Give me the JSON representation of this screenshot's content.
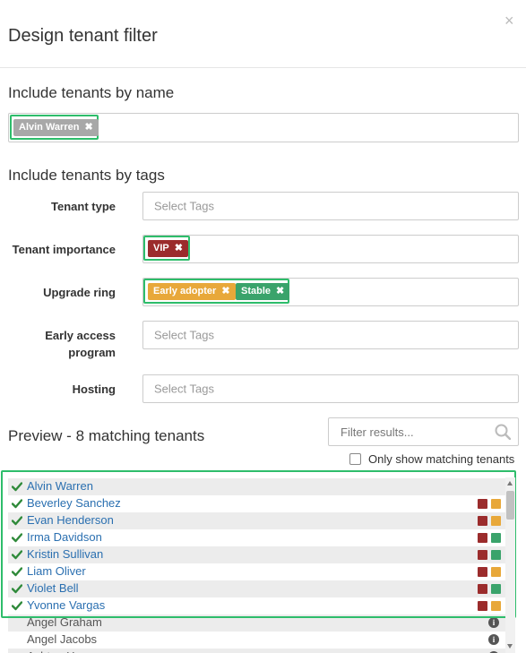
{
  "header": {
    "title": "Design tenant filter",
    "close_glyph": "×"
  },
  "by_name": {
    "title": "Include tenants by name",
    "tags": [
      {
        "label": "Alvin Warren",
        "remove": "✖"
      }
    ]
  },
  "by_tags": {
    "title": "Include tenants by tags",
    "rows": [
      {
        "label": "Tenant type",
        "placeholder": "Select Tags"
      },
      {
        "label": "Tenant importance",
        "tags": [
          {
            "label": "VIP",
            "remove": "✖"
          }
        ]
      },
      {
        "label": "Upgrade ring",
        "tags": [
          {
            "label": "Early adopter",
            "remove": "✖"
          },
          {
            "label": "Stable",
            "remove": "✖"
          }
        ]
      },
      {
        "label_line1": "Early access",
        "label_line2": "program",
        "placeholder": "Select Tags"
      },
      {
        "label": "Hosting",
        "placeholder": "Select Tags"
      }
    ]
  },
  "preview": {
    "title": "Preview - 8 matching tenants",
    "filter_placeholder": "Filter results...",
    "only_matching_label": "Only show matching tenants",
    "tenants": [
      {
        "name": "Alvin Warren",
        "matching": true,
        "tags": []
      },
      {
        "name": "Beverley Sanchez",
        "matching": true,
        "tags": [
          "#9b2c2c",
          "#e8a83a"
        ]
      },
      {
        "name": "Evan Henderson",
        "matching": true,
        "tags": [
          "#9b2c2c",
          "#e8a83a"
        ]
      },
      {
        "name": "Irma Davidson",
        "matching": true,
        "tags": [
          "#9b2c2c",
          "#3aa36b"
        ]
      },
      {
        "name": "Kristin Sullivan",
        "matching": true,
        "tags": [
          "#9b2c2c",
          "#3aa36b"
        ]
      },
      {
        "name": "Liam Oliver",
        "matching": true,
        "tags": [
          "#9b2c2c",
          "#e8a83a"
        ]
      },
      {
        "name": "Violet Bell",
        "matching": true,
        "tags": [
          "#9b2c2c",
          "#3aa36b"
        ]
      },
      {
        "name": "Yvonne Vargas",
        "matching": true,
        "tags": [
          "#9b2c2c",
          "#e8a83a"
        ]
      },
      {
        "name": "Angel Graham",
        "matching": false,
        "info_glyph": "i"
      },
      {
        "name": "Angel Jacobs",
        "matching": false,
        "info_glyph": "i"
      },
      {
        "name": "Ashton Harrs",
        "matching": false,
        "info_glyph": "i"
      }
    ]
  },
  "colors": {
    "highlight": "#2ebd6b",
    "vip": "#9b2c2c",
    "early_adopter": "#e8a83a",
    "stable": "#3aa36b",
    "name_tag": "#a8a8a8",
    "link": "#2a6fb0"
  }
}
